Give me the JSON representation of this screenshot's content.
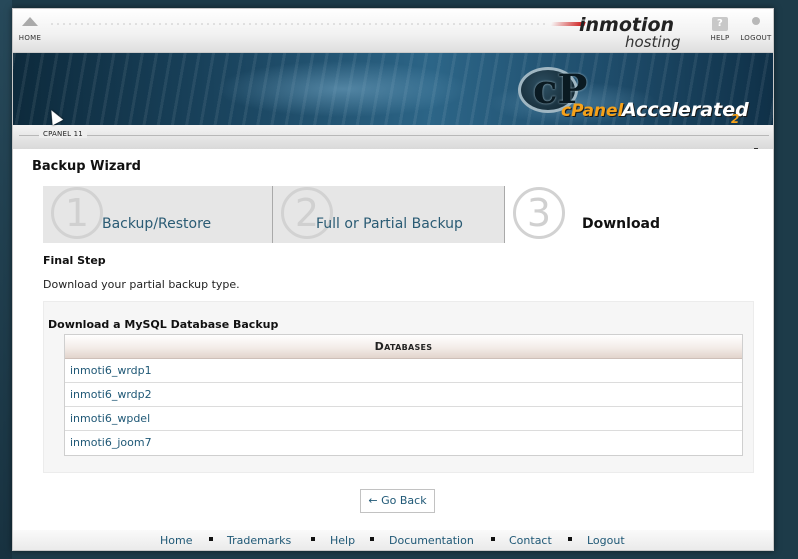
{
  "header": {
    "home_label": "HOME",
    "help_label": "HELP",
    "logout_label": "LOGOUT",
    "help_icon_glyph": "?",
    "brand_name": "inmotion",
    "brand_sub": "hosting",
    "brand_color": "#cc1111"
  },
  "banner": {
    "cpanel_logo_letter": "cP",
    "cpanel_text": "cPanel",
    "accelerated_text": "Accelerated",
    "accelerated_num": "2",
    "version_label": "CPANEL 11",
    "accent_color": "#f6a21a"
  },
  "main": {
    "page_title": "Backup Wizard",
    "steps": [
      {
        "number": "1",
        "label": "Backup/Restore"
      },
      {
        "number": "2",
        "label": "Full or Partial Backup"
      },
      {
        "number": "3",
        "label": "Download"
      }
    ],
    "final_title": "Final Step",
    "final_desc": "Download your partial backup type.",
    "panel_title": "Download a MySQL Database Backup",
    "table_header": "Databases",
    "databases": [
      "inmoti6_wrdp1",
      "inmoti6_wrdp2",
      "inmoti6_wpdel",
      "inmoti6_joom7"
    ],
    "go_back_label": "← Go Back"
  },
  "footer": {
    "links": [
      "Home",
      "Trademarks",
      "Help",
      "Documentation",
      "Contact",
      "Logout"
    ]
  },
  "colors": {
    "link": "#1f5876",
    "step_inactive_bg": "#e6e6e6"
  }
}
